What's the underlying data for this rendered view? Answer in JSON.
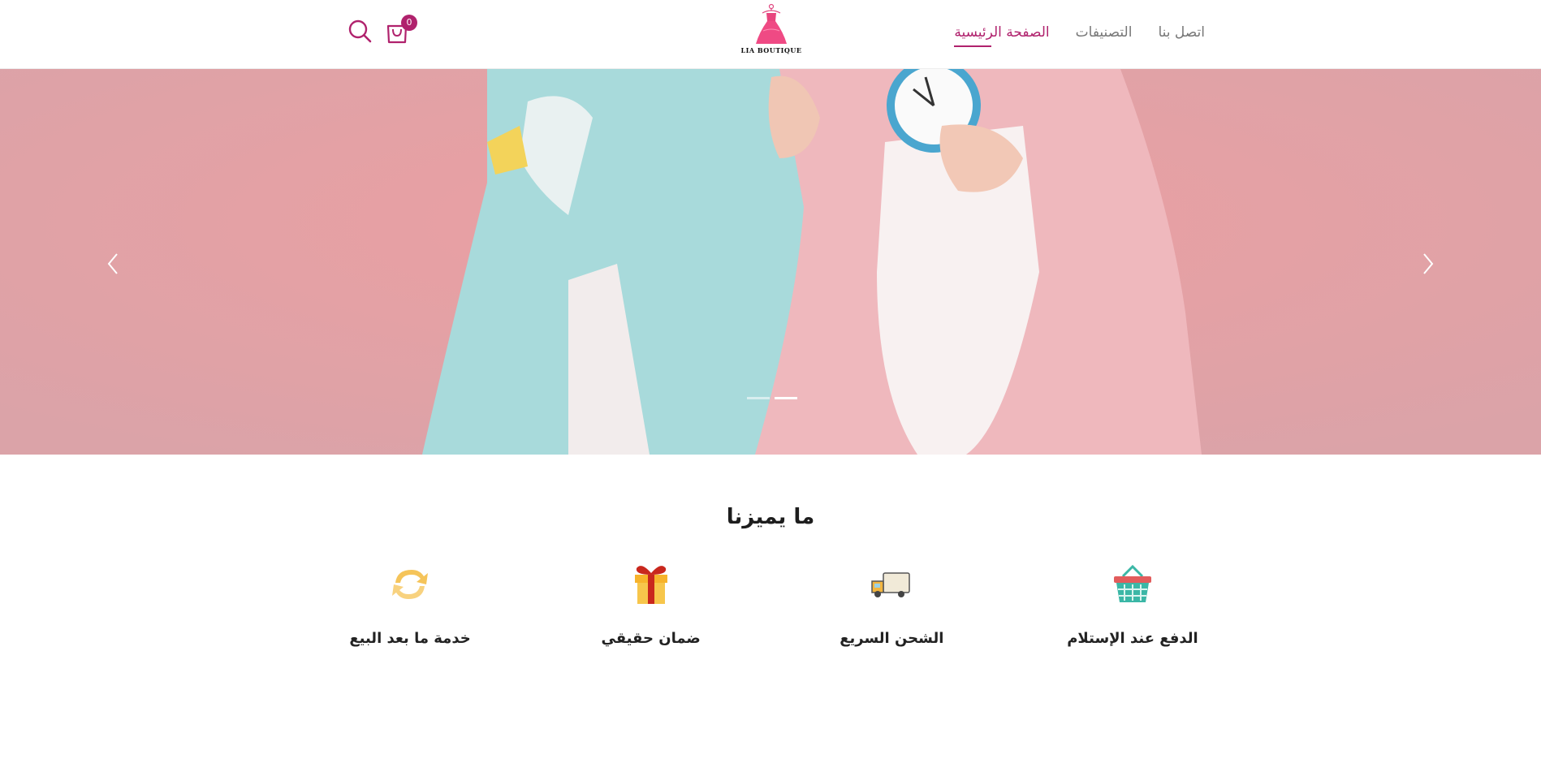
{
  "header": {
    "nav": [
      {
        "label": "الصفحة الرئيسية",
        "active": true
      },
      {
        "label": "التصنيفات",
        "active": false
      },
      {
        "label": "اتصل بنا",
        "active": false
      }
    ],
    "logo_text": "LIA BOUTIQUE",
    "cart_count": "0",
    "accent_color": "#b0226d"
  },
  "hero": {
    "slides_count": 2,
    "active_slide": 2,
    "prev_icon": "chevron-left-icon",
    "next_icon": "chevron-right-icon"
  },
  "features": {
    "title": "ما يميزنا",
    "items": [
      {
        "label": "الدفع عند الإستلام",
        "icon": "basket-icon"
      },
      {
        "label": "الشحن السريع",
        "icon": "truck-icon"
      },
      {
        "label": "ضمان حقيقي",
        "icon": "gift-icon"
      },
      {
        "label": "خدمة ما بعد البيع",
        "icon": "refresh-icon"
      }
    ]
  }
}
